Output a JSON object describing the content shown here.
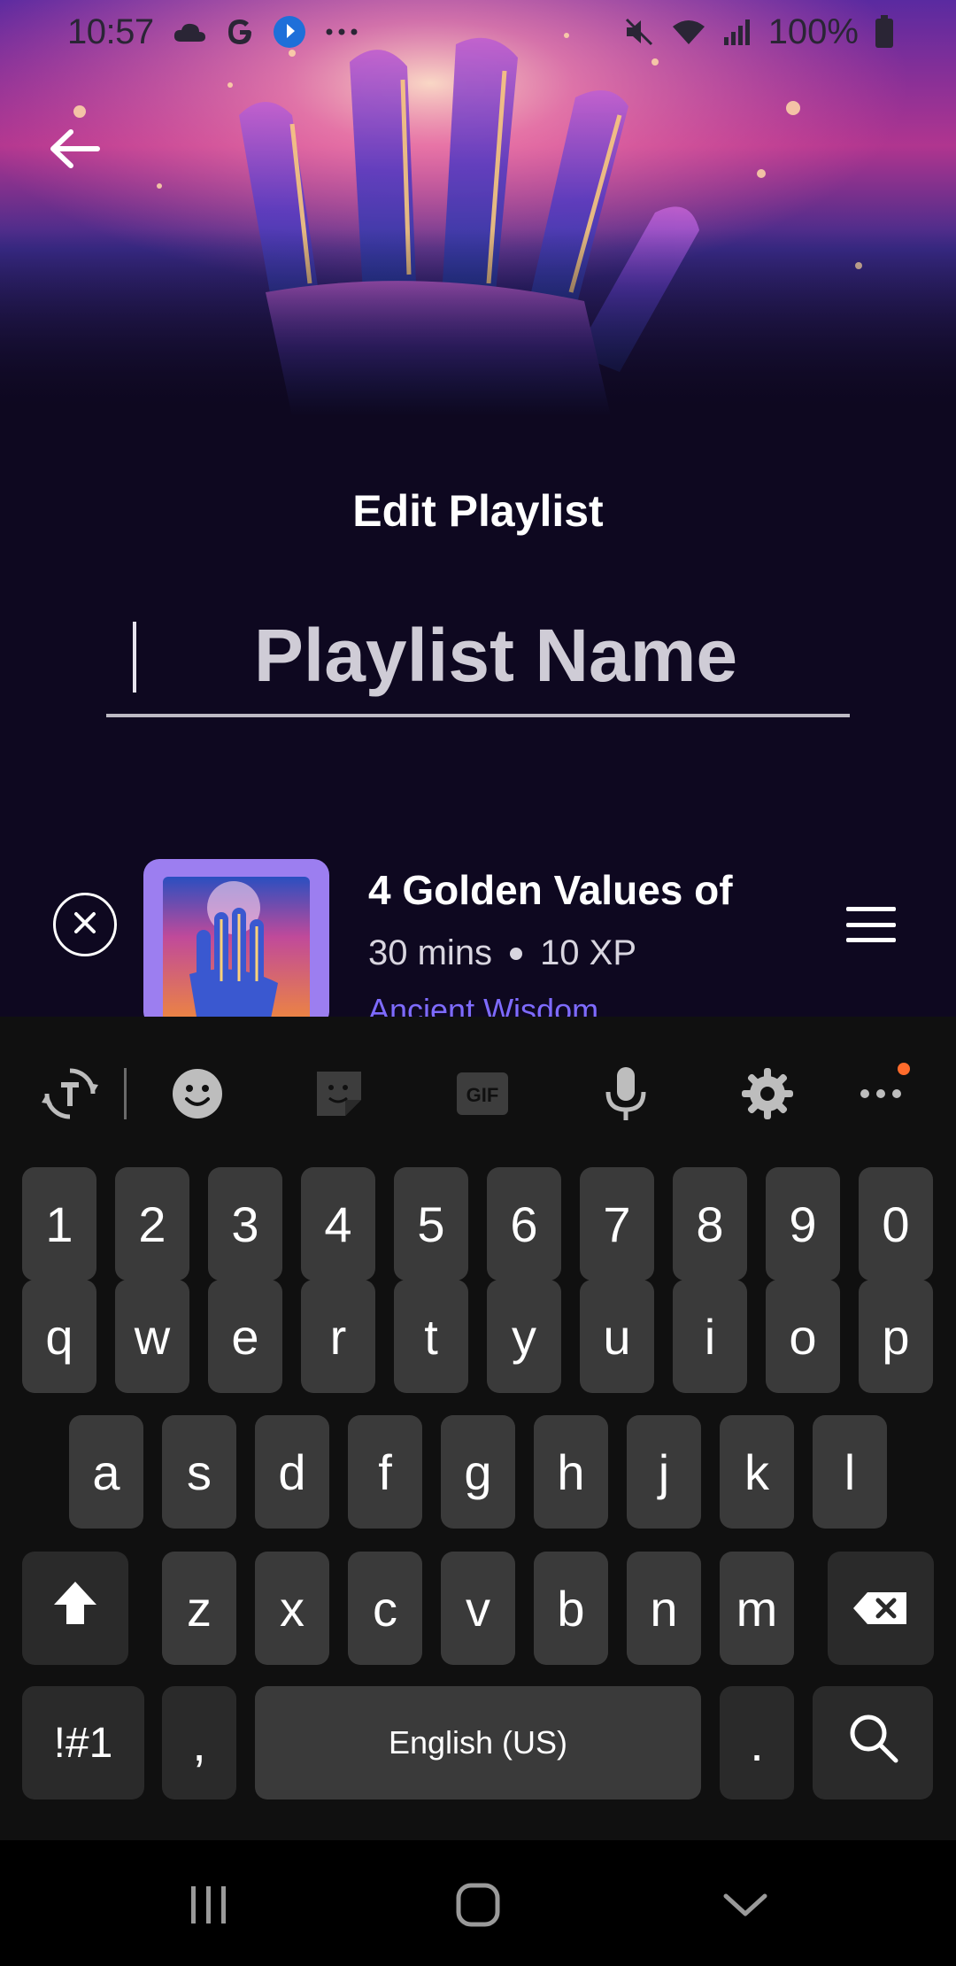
{
  "status_bar": {
    "time": "10:57",
    "battery": "100%",
    "icons": [
      "cloud-icon",
      "google-icon",
      "app-badge-icon",
      "more-notifications-icon",
      "mute-icon",
      "wifi-icon",
      "signal-icon",
      "battery-icon"
    ]
  },
  "header": {
    "back_icon": "arrow-left-icon",
    "title": "Edit Playlist"
  },
  "playlist": {
    "name_placeholder": "Playlist Name",
    "name_value": ""
  },
  "tracks": [
    {
      "title": "4 Golden Values of",
      "duration": "30 mins",
      "xp": "10 XP",
      "subtitle": "Ancient Wisdom"
    }
  ],
  "keyboard": {
    "toolbar": [
      "translate-icon",
      "emoji-icon",
      "sticker-icon",
      "gif-icon",
      "microphone-icon",
      "settings-icon",
      "more-icon"
    ],
    "gif_label": "GIF",
    "row_numbers": [
      "1",
      "2",
      "3",
      "4",
      "5",
      "6",
      "7",
      "8",
      "9",
      "0"
    ],
    "row_1": [
      "q",
      "w",
      "e",
      "r",
      "t",
      "y",
      "u",
      "i",
      "o",
      "p"
    ],
    "row_2": [
      "a",
      "s",
      "d",
      "f",
      "g",
      "h",
      "j",
      "k",
      "l"
    ],
    "row_3": [
      "z",
      "x",
      "c",
      "v",
      "b",
      "n",
      "m"
    ],
    "symbols_key": "!#1",
    "comma_key": ",",
    "space_label": "English (US)",
    "period_key": ".",
    "accent_color": "#ff6b2b"
  },
  "nav_bar": {
    "icons": [
      "recent-apps-icon",
      "home-icon",
      "hide-keyboard-icon"
    ]
  },
  "colors": {
    "background": "#0e0820",
    "link": "#7e6bff",
    "thumbnail_frame": "#9c7ef0"
  }
}
